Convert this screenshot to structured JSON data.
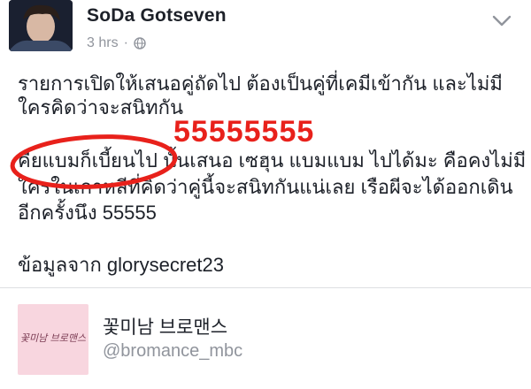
{
  "post": {
    "author": "SoDa Gotseven",
    "time": "3 hrs",
    "separator": "·",
    "lines": [
      "รายการเปิดให้เสนอคู่ถัดไป ต้องเป็นคู่ที่เคมีเข้ากัน และไม่มี",
      "ใครคิดว่าจะสนิทกัน",
      "คียแบมก็เบี้ยนไป นั้นเสนอ เซฮุน แบมแบม ไปได้มะ คือคงไม่มี",
      "ใครในเกาหลีที่คิดว่าคู่นี้จะสนิทกันแน่เลย เรือผีจะได้ออกเดิน",
      "อีกครั้งนึง 55555",
      "ข้อมูลจาก glorysecret23"
    ],
    "overlay_text": "55555555"
  },
  "shared": {
    "thumb_text": "꽃미남 브로맨스",
    "title": "꽃미남 브로맨스",
    "handle": "@bromance_mbc"
  },
  "colors": {
    "accent_red": "#e8211b",
    "meta_gray": "#90949c",
    "text": "#1d2129",
    "thumb_bg": "#f8d6df"
  },
  "icons": {
    "privacy": "globe-icon",
    "menu": "chevron-down-icon"
  }
}
